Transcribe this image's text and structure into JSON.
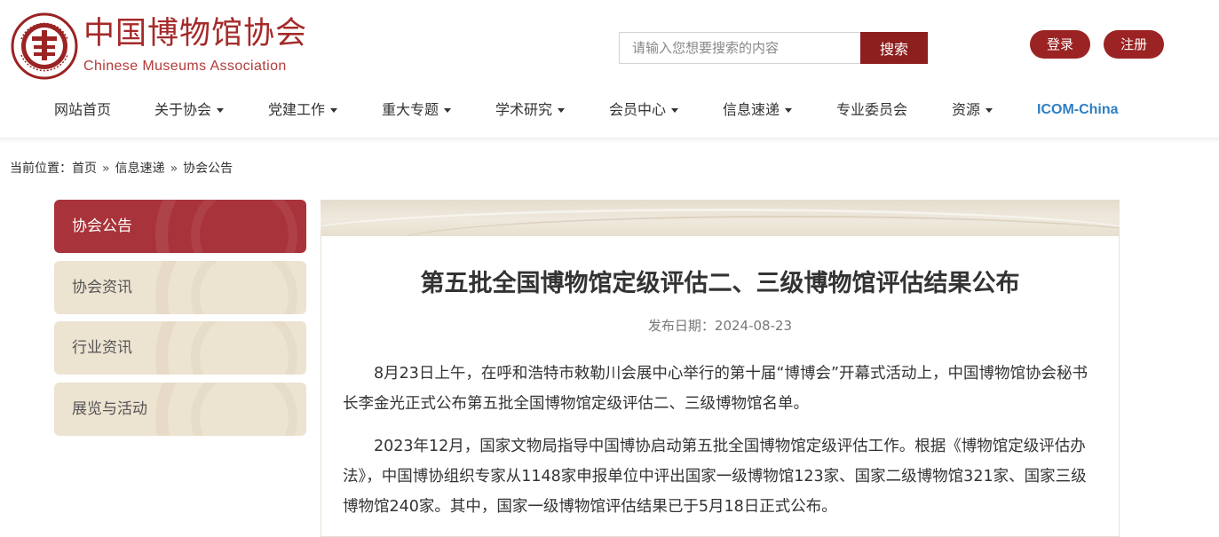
{
  "header": {
    "logo_icon": "museum-seal-logo",
    "brand_cn": "中国博物馆协会",
    "brand_en": "Chinese Museums Association",
    "search": {
      "placeholder": "请输入您想要搜索的内容",
      "button_label": "搜索"
    },
    "login_label": "登录",
    "register_label": "注册",
    "accent_color": "#9b2323"
  },
  "nav": {
    "items": [
      {
        "label": "网站首页",
        "dropdown": false
      },
      {
        "label": "关于协会",
        "dropdown": true
      },
      {
        "label": "党建工作",
        "dropdown": true
      },
      {
        "label": "重大专题",
        "dropdown": true
      },
      {
        "label": "学术研究",
        "dropdown": true
      },
      {
        "label": "会员中心",
        "dropdown": true
      },
      {
        "label": "信息速递",
        "dropdown": true
      },
      {
        "label": "专业委员会",
        "dropdown": false
      },
      {
        "label": "资源",
        "dropdown": true
      },
      {
        "label": "ICOM-China",
        "dropdown": false
      }
    ]
  },
  "breadcrumb": {
    "prefix": "当前位置：",
    "items": [
      "首页",
      "信息速递",
      "协会公告"
    ],
    "separator": "»"
  },
  "sidebar": {
    "items": [
      {
        "label": "协会公告",
        "active": true
      },
      {
        "label": "协会资讯",
        "active": false
      },
      {
        "label": "行业资讯",
        "active": false
      },
      {
        "label": "展览与活动",
        "active": false
      }
    ]
  },
  "article": {
    "title": "第五批全国博物馆定级评估二、三级博物馆评估结果公布",
    "date_label": "发布日期：2024-08-23",
    "paragraphs": [
      "8月23日上午，在呼和浩特市敕勒川会展中心举行的第十届“博博会”开幕式活动上，中国博物馆协会秘书长李金光正式公布第五批全国博物馆定级评估二、三级博物馆名单。",
      "2023年12月，国家文物局指导中国博协启动第五批全国博物馆定级评估工作。根据《博物馆定级评估办法》，中国博协组织专家从1148家申报单位中评出国家一级博物馆123家、国家二级博物馆321家、国家三级博物馆240家。其中，国家一级博物馆评估结果已于5月18日正式公布。"
    ]
  }
}
